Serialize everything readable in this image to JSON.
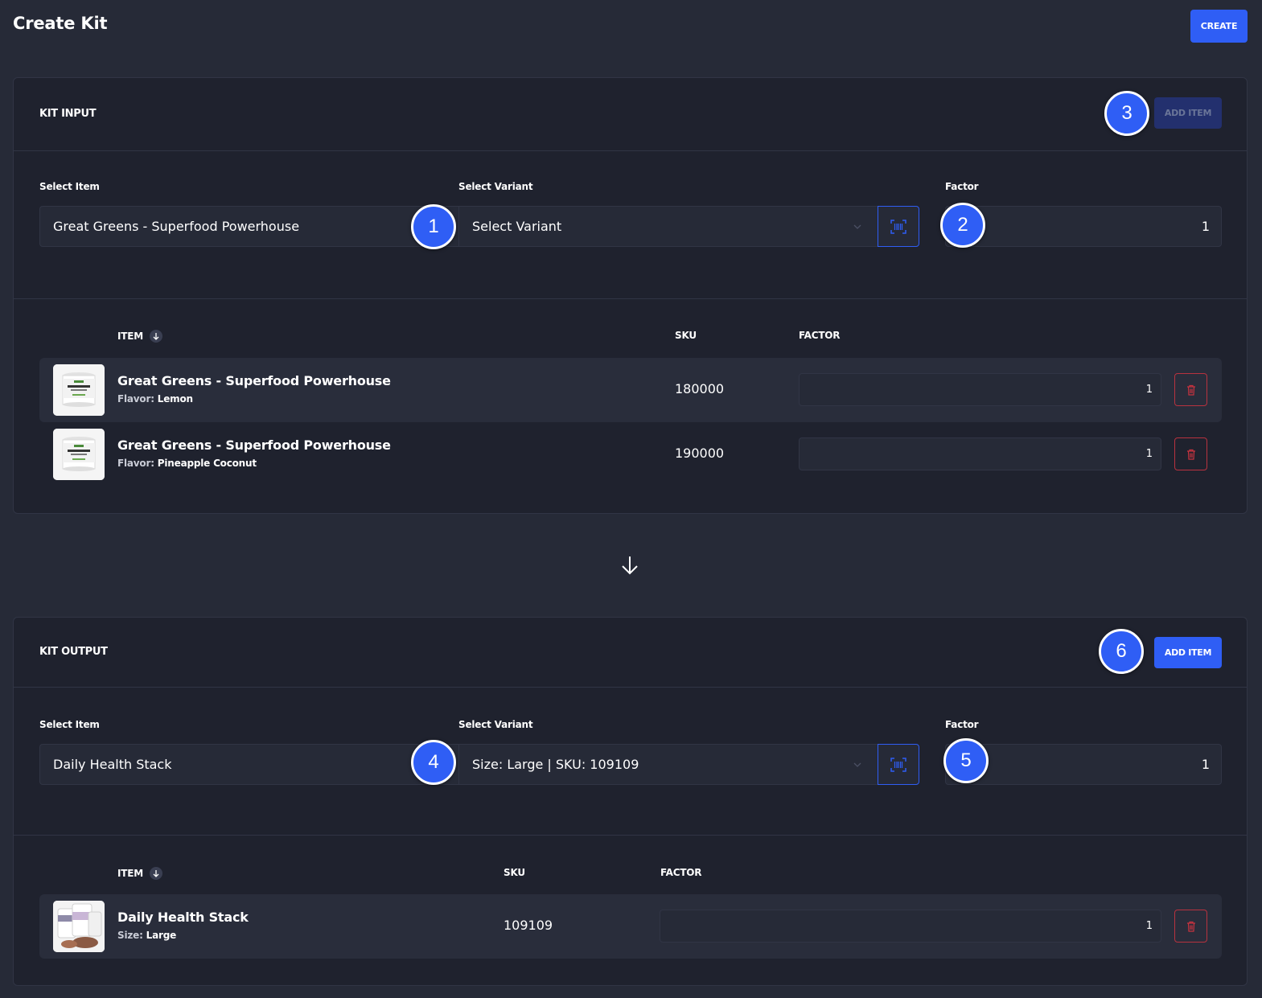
{
  "page": {
    "title": "Create Kit",
    "create_label": "CREATE"
  },
  "colors": {
    "accent": "#2f5ef5",
    "danger": "#b8323f",
    "background": "#262a37",
    "card": "#1f222e"
  },
  "kit_input": {
    "title": "KIT INPUT",
    "add_item_label": "ADD ITEM",
    "add_item_disabled": true,
    "form": {
      "item_label": "Select Item",
      "item_value": "Great Greens - Superfood Powerhouse",
      "variant_label": "Select Variant",
      "variant_value": "Select Variant",
      "factor_label": "Factor",
      "factor_value": "1"
    },
    "table": {
      "col_item": "ITEM",
      "col_sku": "SKU",
      "col_factor": "FACTOR",
      "rows": [
        {
          "name": "Great Greens - Superfood Powerhouse",
          "attr_key": "Flavor:",
          "attr_value": "Lemon",
          "sku": "180000",
          "factor": "1"
        },
        {
          "name": "Great Greens - Superfood Powerhouse",
          "attr_key": "Flavor:",
          "attr_value": "Pineapple Coconut",
          "sku": "190000",
          "factor": "1"
        }
      ]
    }
  },
  "kit_output": {
    "title": "KIT OUTPUT",
    "add_item_label": "ADD ITEM",
    "form": {
      "item_label": "Select Item",
      "item_value": "Daily Health Stack",
      "variant_label": "Select Variant",
      "variant_value": "Size: Large | SKU: 109109",
      "factor_label": "Factor",
      "factor_value": "1"
    },
    "table": {
      "col_item": "ITEM",
      "col_sku": "SKU",
      "col_factor": "FACTOR",
      "rows": [
        {
          "name": "Daily Health Stack",
          "attr_key": "Size:",
          "attr_value": "Large",
          "sku": "109109",
          "factor": "1"
        }
      ]
    }
  },
  "badges": [
    "1",
    "2",
    "3",
    "4",
    "5",
    "6"
  ],
  "icons": {
    "sort": "arrow-down-icon",
    "scan": "barcode-scan-icon",
    "delete": "trash-icon",
    "flow": "arrow-down-icon",
    "dropdown": "chevron-down-icon"
  }
}
